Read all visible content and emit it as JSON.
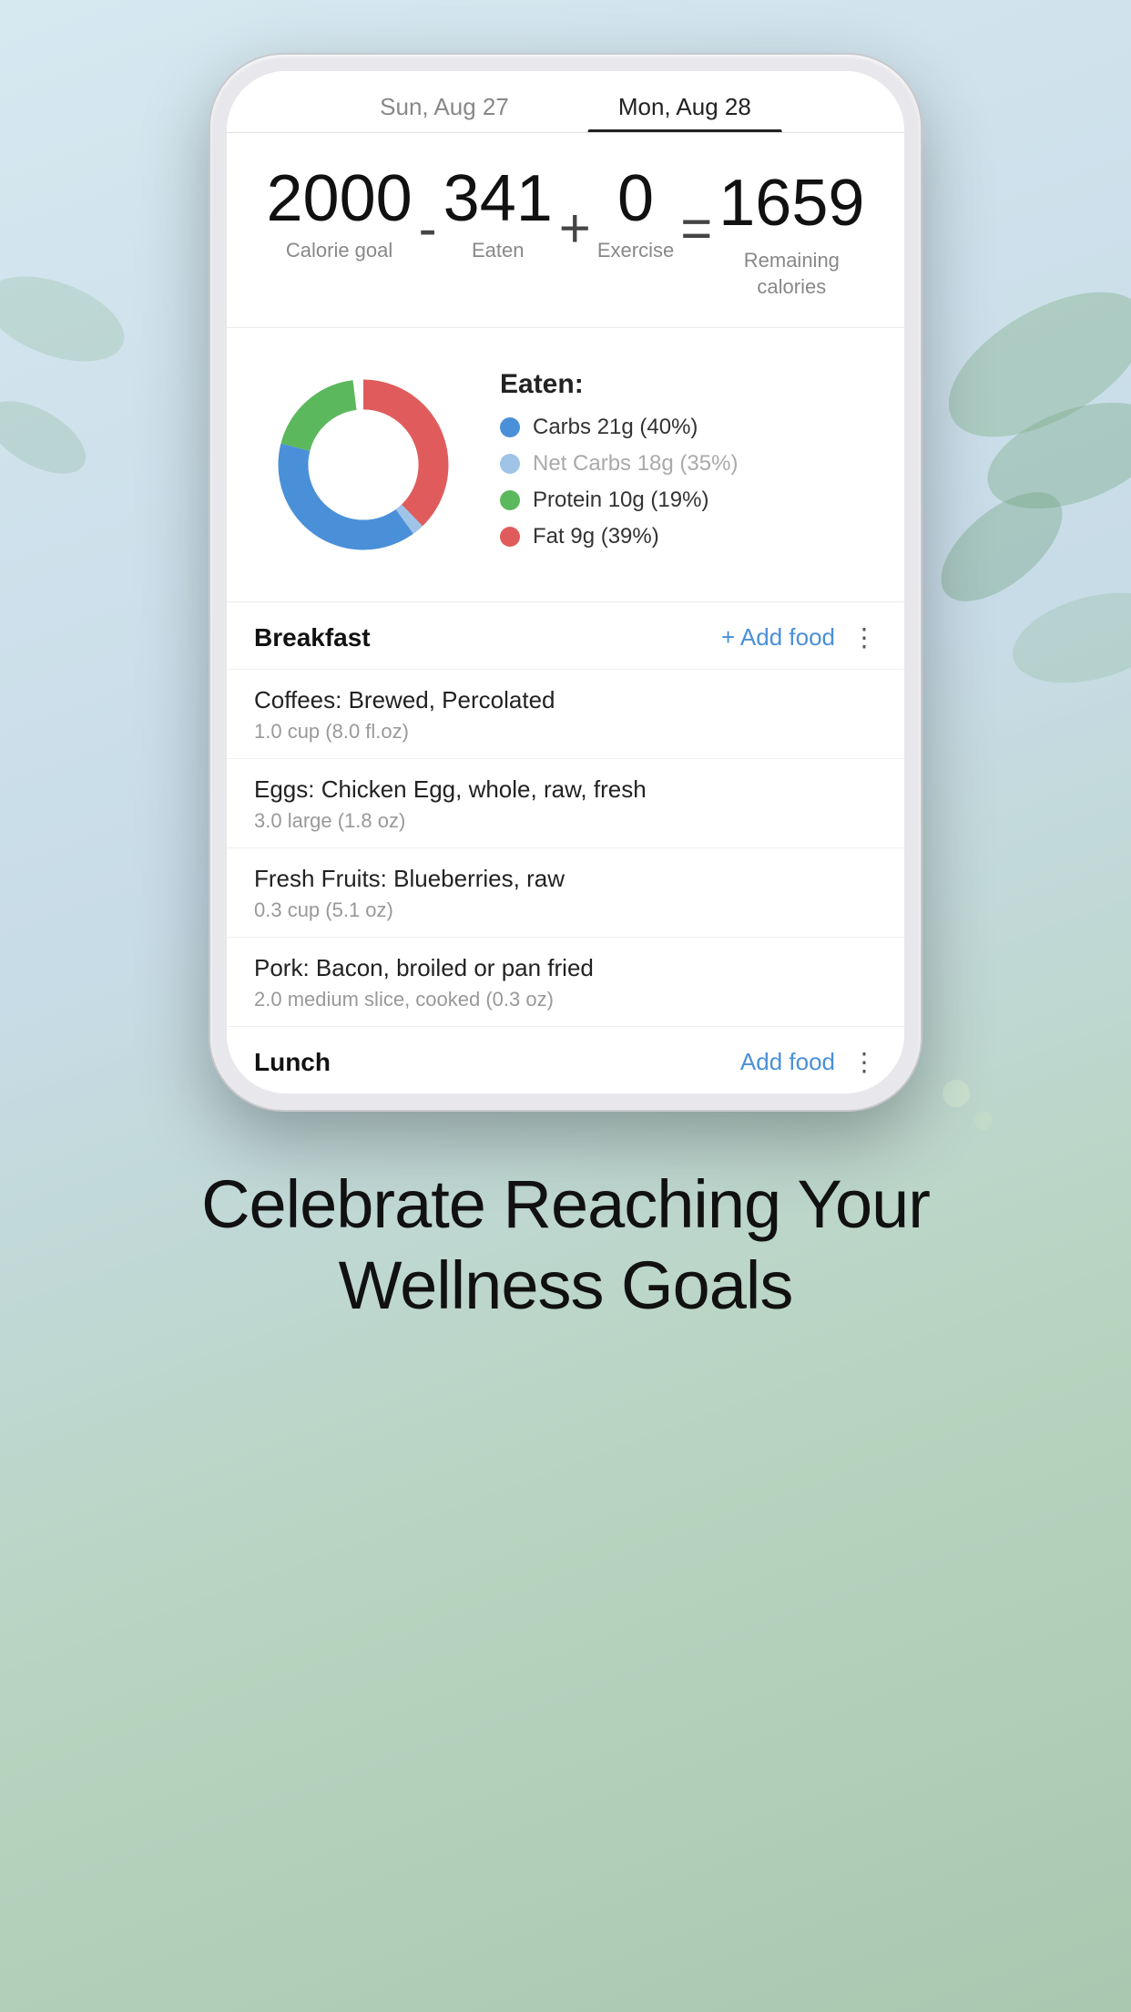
{
  "background": {
    "gradient_start": "#d6e8f0",
    "gradient_end": "#a8c8b0"
  },
  "phone": {
    "date_tabs": [
      {
        "label": "Sun, Aug 27",
        "active": false
      },
      {
        "label": "Mon, Aug 28",
        "active": true
      }
    ],
    "calorie_summary": {
      "goal": {
        "value": "2000",
        "label": "Calorie goal"
      },
      "op_minus": "-",
      "eaten": {
        "value": "341",
        "label": "Eaten"
      },
      "op_plus": "+",
      "exercise": {
        "value": "0",
        "label": "Exercise"
      },
      "op_equals": "=",
      "remaining": {
        "value": "1659",
        "label": "Remaining\ncalories"
      }
    },
    "macro_chart": {
      "title": "Eaten:",
      "legend": [
        {
          "color": "#4a90d9",
          "text": "Carbs 21g (40%)",
          "muted": false
        },
        {
          "color": "#a0c4e8",
          "text": "Net Carbs 18g (35%)",
          "muted": true
        },
        {
          "color": "#5cb85c",
          "text": "Protein 10g (19%)",
          "muted": false
        },
        {
          "color": "#e05c5c",
          "text": "Fat 9g (39%)",
          "muted": false
        }
      ],
      "donut": {
        "carbs_pct": 40,
        "protein_pct": 19,
        "fat_pct": 39,
        "net_carbs_pct": 35
      }
    },
    "breakfast": {
      "title": "Breakfast",
      "add_food_label": "+ Add food",
      "items": [
        {
          "name": "Coffees: Brewed, Percolated",
          "serving": "1.0 cup (8.0 fl.oz)"
        },
        {
          "name": "Eggs: Chicken Egg, whole, raw, fresh",
          "serving": "3.0 large (1.8 oz)"
        },
        {
          "name": "Fresh Fruits: Blueberries, raw",
          "serving": "0.3 cup (5.1 oz)"
        },
        {
          "name": "Pork: Bacon, broiled or pan fried",
          "serving": "2.0 medium slice, cooked (0.3 oz)"
        }
      ]
    },
    "lunch_partial": {
      "title": "Lunch",
      "add_food_label": "Add food"
    }
  },
  "bottom_heading": "Celebrate Reaching Your\nWellness Goals"
}
